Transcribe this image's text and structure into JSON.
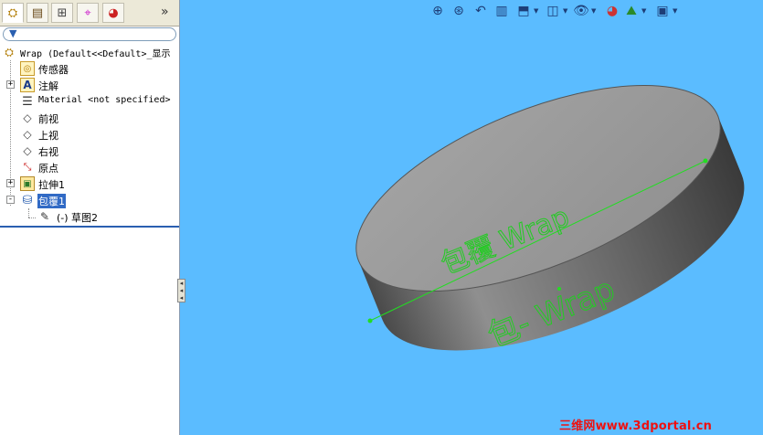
{
  "tree_root_label": "Wrap  (Default<<Default>_显示",
  "tree_items": [
    {
      "label": "传感器",
      "icon": "sensor-icon",
      "expander": ""
    },
    {
      "label": "注解",
      "icon": "annotation-icon",
      "expander": "+"
    },
    {
      "label": "Material <not specified>",
      "icon": "material-icon",
      "expander": ""
    },
    {
      "label": "前视",
      "icon": "plane-icon",
      "expander": ""
    },
    {
      "label": "上视",
      "icon": "plane-icon",
      "expander": ""
    },
    {
      "label": "右视",
      "icon": "plane-icon",
      "expander": ""
    },
    {
      "label": "原点",
      "icon": "origin-icon",
      "expander": ""
    },
    {
      "label": "拉伸1",
      "icon": "extrude-icon",
      "expander": "+"
    },
    {
      "label": "包覆1",
      "icon": "wrap-icon",
      "expander": "-"
    }
  ],
  "sketch_item_label": "(-) 草图2",
  "model_text": {
    "top_face": "包覆 Wrap",
    "side_face": "包- Wrap"
  },
  "watermark": "三维网www.3dportal.cn",
  "colors": {
    "viewport_bg": "#5bbcff",
    "sketch_green": "#22dd22",
    "selection_blue": "#316ac5"
  }
}
